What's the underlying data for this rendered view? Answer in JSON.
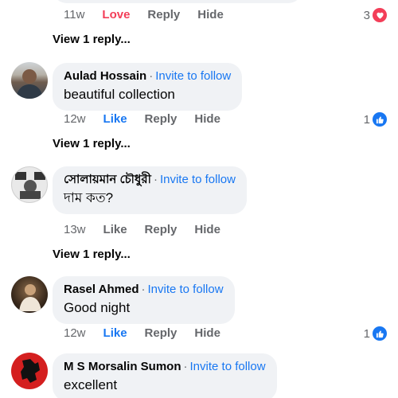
{
  "comments": [
    {
      "time": "11w",
      "reaction_label": "Love",
      "reply_label": "Reply",
      "hide_label": "Hide",
      "reaction_count": "3",
      "view_replies": "View 1 reply..."
    },
    {
      "author": "Aulad Hossain",
      "invite": "Invite to follow",
      "text": "beautiful collection",
      "time": "12w",
      "reaction_label": "Like",
      "reply_label": "Reply",
      "hide_label": "Hide",
      "reaction_count": "1",
      "view_replies": "View 1 reply..."
    },
    {
      "author": "সোলায়মান চৌধুরী",
      "invite": "Invite to follow",
      "text": "দাম কত?",
      "time": "13w",
      "reaction_label": "Like",
      "reply_label": "Reply",
      "hide_label": "Hide",
      "view_replies": "View 1 reply..."
    },
    {
      "author": "Rasel Ahmed",
      "invite": "Invite to follow",
      "text": "Good night",
      "time": "12w",
      "reaction_label": "Like",
      "reply_label": "Reply",
      "hide_label": "Hide",
      "reaction_count": "1"
    },
    {
      "author": "M S Morsalin Sumon",
      "invite": "Invite to follow",
      "text": "excellent"
    }
  ],
  "separator": "·",
  "colors": {
    "link_blue": "#1877f2",
    "love_red": "#f33e58",
    "bubble_bg": "#f0f2f5",
    "meta_gray": "#65676b"
  }
}
